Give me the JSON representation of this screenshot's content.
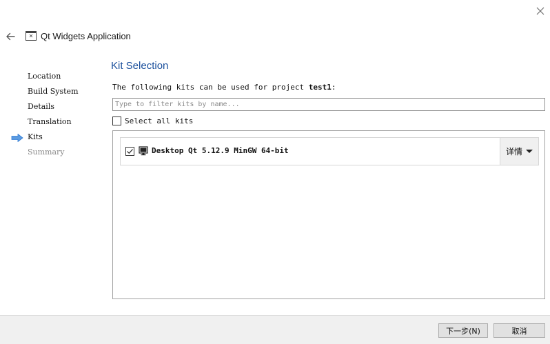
{
  "header": {
    "title": "Qt Widgets Application",
    "back_icon": "back-arrow-icon",
    "app_icon": "window-icon",
    "close_icon": "close-icon"
  },
  "steps": [
    {
      "label": "Location",
      "state": "done"
    },
    {
      "label": "Build System",
      "state": "done"
    },
    {
      "label": "Details",
      "state": "done"
    },
    {
      "label": "Translation",
      "state": "done"
    },
    {
      "label": "Kits",
      "state": "current"
    },
    {
      "label": "Summary",
      "state": "pending"
    }
  ],
  "main": {
    "title": "Kit Selection",
    "description_prefix": "The following kits can be used for project ",
    "project_name": "test1",
    "description_suffix": ":",
    "filter": {
      "value": "",
      "placeholder": "Type to filter kits by name..."
    },
    "select_all": {
      "label": "Select all kits",
      "checked": false
    },
    "kits": [
      {
        "name": "Desktop Qt 5.12.9 MinGW 64-bit",
        "checked": true,
        "details_label": "详情"
      }
    ]
  },
  "footer": {
    "next_label": "下一步(N)",
    "cancel_label": "取消"
  },
  "colors": {
    "accent_title": "#1a4f9c",
    "step_arrow": "#2f7bd6"
  }
}
